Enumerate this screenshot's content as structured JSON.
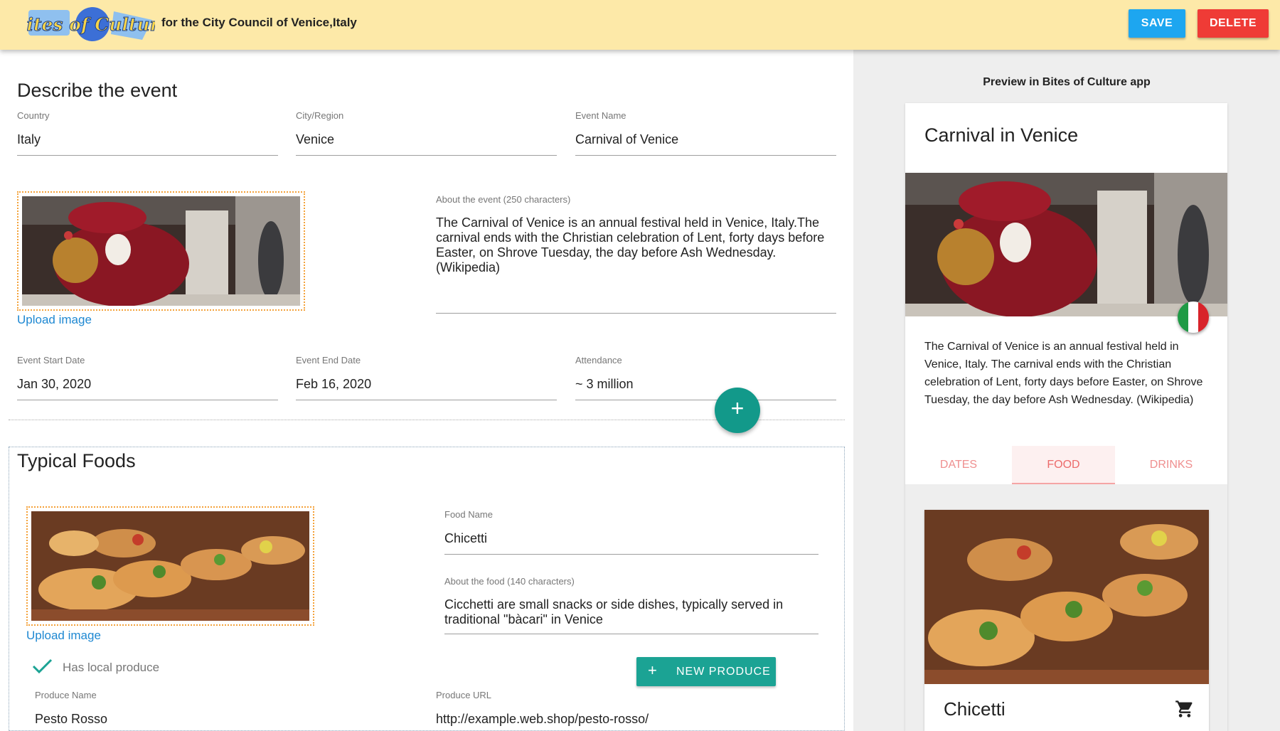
{
  "header": {
    "logo_alt": "Bites of Culture",
    "tagline": "for the City Council of Venice,Italy",
    "save_label": "SAVE",
    "delete_label": "DELETE"
  },
  "event": {
    "section_title": "Describe the event",
    "country": {
      "label": "Country",
      "value": "Italy"
    },
    "city": {
      "label": "City/Region",
      "value": "Venice"
    },
    "name": {
      "label": "Event Name",
      "value": "Carnival of Venice"
    },
    "upload_label": "Upload image",
    "about": {
      "label": "About the event (250 characters)",
      "value": "The Carnival of Venice is an annual festival held in Venice, Italy.The carnival ends with the Christian celebration of Lent, forty days before Easter, on Shrove Tuesday, the day before Ash Wednesday. (Wikipedia)"
    },
    "start": {
      "label": "Event Start Date",
      "value": "Jan 30, 2020"
    },
    "end": {
      "label": "Event End Date",
      "value": "Feb 16, 2020"
    },
    "attendance": {
      "label": "Attendance",
      "value": "~ 3 million"
    }
  },
  "foods": {
    "section_title": "Typical Foods",
    "add_icon": "+",
    "upload_label": "Upload image",
    "food_name": {
      "label": "Food Name",
      "value": "Chicetti"
    },
    "about": {
      "label": "About the food (140 characters)",
      "value": "Cicchetti are small snacks or side dishes, typically served in traditional \"bàcari\" in Venice"
    },
    "has_local": "Has local produce",
    "new_produce_icon": "+",
    "new_produce_label": "NEW PRODUCE",
    "produce_name": {
      "label": "Produce Name",
      "value": "Pesto Rosso"
    },
    "produce_url": {
      "label": "Produce URL",
      "value": "http://example.web.shop/pesto-rosso/"
    }
  },
  "preview": {
    "heading": "Preview in Bites of Culture app",
    "title": "Carnival in Venice",
    "description": "The Carnival of Venice is an annual festival held in Venice, Italy. The carnival ends with the Christian celebration of Lent, forty days before Easter, on Shrove Tuesday, the day before Ash Wednesday. (Wikipedia)",
    "tabs": [
      "DATES",
      "FOOD",
      "DRINKS"
    ],
    "active_tab": "FOOD",
    "food_title": "Chicetti"
  },
  "colors": {
    "header_bg": "#fde9a8",
    "save": "#1da6f0",
    "delete": "#ef3b36",
    "accent_teal": "#12998a",
    "link_blue": "#1e88d2",
    "tab_pink": "#ec6b6b"
  },
  "icons": [
    "logo-icon",
    "plus-icon",
    "check-icon",
    "cart-icon",
    "italy-flag-icon"
  ]
}
